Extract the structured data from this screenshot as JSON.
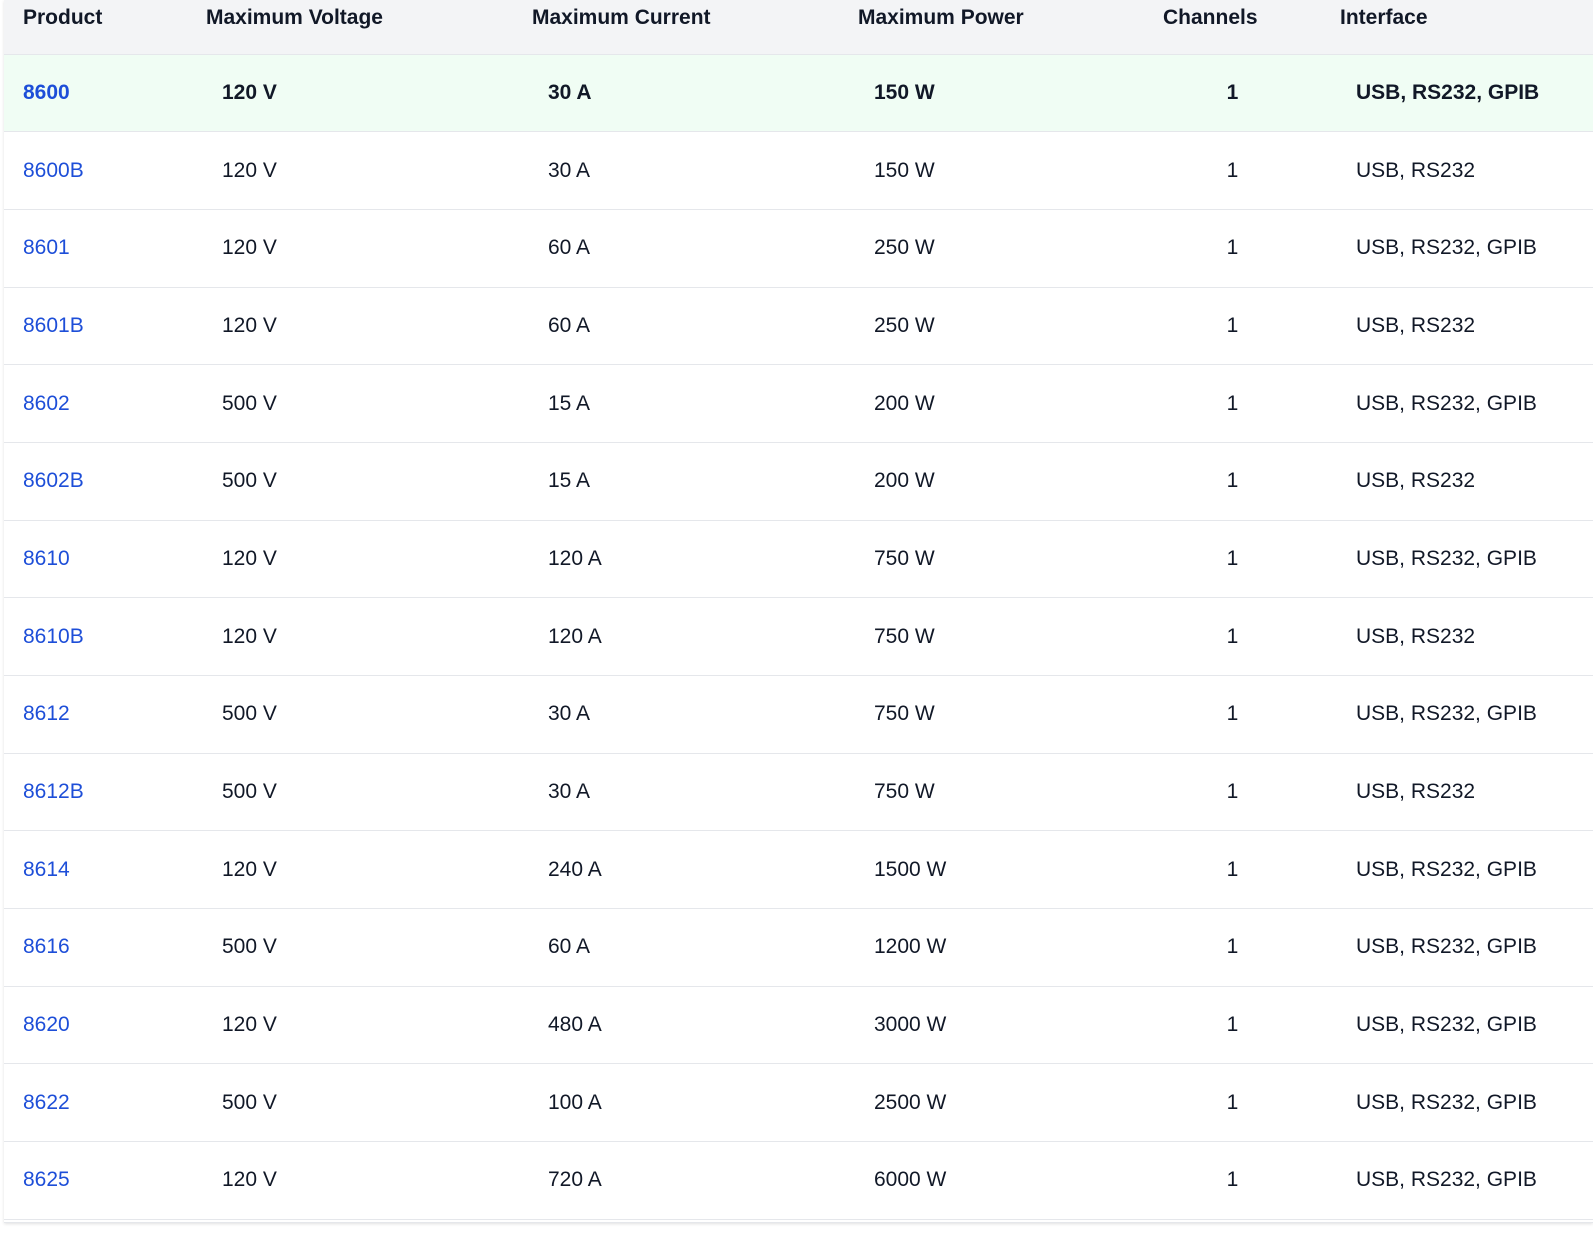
{
  "headers": {
    "product": "Product",
    "voltage": "Maximum Voltage",
    "current": "Maximum Current",
    "power": "Maximum Power",
    "channels": "Channels",
    "interface": "Interface"
  },
  "rows": [
    {
      "product": "8600",
      "voltage": "120 V",
      "current": "30 A",
      "power": "150 W",
      "channels": "1",
      "interface": "USB, RS232, GPIB",
      "highlight": true
    },
    {
      "product": "8600B",
      "voltage": "120 V",
      "current": "30 A",
      "power": "150 W",
      "channels": "1",
      "interface": "USB, RS232"
    },
    {
      "product": "8601",
      "voltage": "120 V",
      "current": "60 A",
      "power": "250 W",
      "channels": "1",
      "interface": "USB, RS232, GPIB"
    },
    {
      "product": "8601B",
      "voltage": "120 V",
      "current": "60 A",
      "power": "250 W",
      "channels": "1",
      "interface": "USB, RS232"
    },
    {
      "product": "8602",
      "voltage": "500 V",
      "current": "15 A",
      "power": "200 W",
      "channels": "1",
      "interface": "USB, RS232, GPIB"
    },
    {
      "product": "8602B",
      "voltage": "500 V",
      "current": "15 A",
      "power": "200 W",
      "channels": "1",
      "interface": "USB, RS232"
    },
    {
      "product": "8610",
      "voltage": "120 V",
      "current": "120 A",
      "power": "750 W",
      "channels": "1",
      "interface": "USB, RS232, GPIB"
    },
    {
      "product": "8610B",
      "voltage": "120 V",
      "current": "120 A",
      "power": "750 W",
      "channels": "1",
      "interface": "USB, RS232"
    },
    {
      "product": "8612",
      "voltage": "500 V",
      "current": "30 A",
      "power": "750 W",
      "channels": "1",
      "interface": "USB, RS232, GPIB"
    },
    {
      "product": "8612B",
      "voltage": "500 V",
      "current": "30 A",
      "power": "750 W",
      "channels": "1",
      "interface": "USB, RS232"
    },
    {
      "product": "8614",
      "voltage": "120 V",
      "current": "240 A",
      "power": "1500 W",
      "channels": "1",
      "interface": "USB, RS232, GPIB"
    },
    {
      "product": "8616",
      "voltage": "500 V",
      "current": "60 A",
      "power": "1200 W",
      "channels": "1",
      "interface": "USB, RS232, GPIB"
    },
    {
      "product": "8620",
      "voltage": "120 V",
      "current": "480 A",
      "power": "3000 W",
      "channels": "1",
      "interface": "USB, RS232, GPIB"
    },
    {
      "product": "8622",
      "voltage": "500 V",
      "current": "100 A",
      "power": "2500 W",
      "channels": "1",
      "interface": "USB, RS232, GPIB"
    },
    {
      "product": "8625",
      "voltage": "120 V",
      "current": "720 A",
      "power": "6000 W",
      "channels": "1",
      "interface": "USB, RS232, GPIB"
    }
  ],
  "colors": {
    "link": "#1d4ed8",
    "header_bg": "#f3f4f6",
    "highlight_bg": "#f0fdf4",
    "border": "#e5e7eb"
  }
}
